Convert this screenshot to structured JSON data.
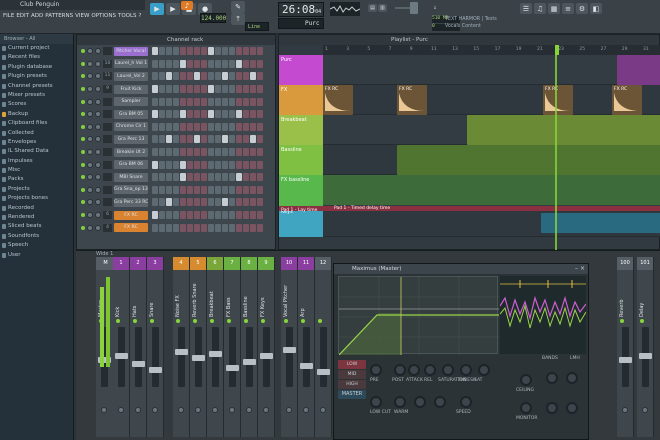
{
  "window": {
    "title": "Club Penguin"
  },
  "menu": [
    "FILE",
    "EDIT",
    "ADD",
    "PATTERNS",
    "VIEW",
    "OPTIONS",
    "TOOLS",
    "?"
  ],
  "transport": {
    "tempo": "124.000",
    "time": "26:08",
    "time_small": "04",
    "pattern": "Purc",
    "line_mode": "Line",
    "cpu": "510 MB",
    "cpu2": "0"
  },
  "hint": {
    "line1": "TEXT HARMOR | Tests",
    "line2": "Vocals Content"
  },
  "browser": {
    "header": "Browser - All",
    "items": [
      "Current project",
      "Recent files",
      "Plugin database",
      "Plugin presets",
      "Channel presets",
      "Mixer presets",
      "Scores",
      "Backup",
      "Clipboard files",
      "Collected",
      "Envelopes",
      "IL Shared Data",
      "Impulses",
      "Misc",
      "Packs",
      "Projects",
      "Projects bones",
      "Recorded",
      "Rendered",
      "Sliced beats",
      "Soundfonts",
      "Speech",
      "User"
    ]
  },
  "channel_rack": {
    "title": "Channel rack",
    "channels": [
      {
        "num": "",
        "name": "Pitcher Vocal"
      },
      {
        "num": "10",
        "name": "Laurel_h Vol 1"
      },
      {
        "num": "11",
        "name": "Laurel_Vol 2"
      },
      {
        "num": "9",
        "name": "Fruit Kick"
      },
      {
        "num": "",
        "name": "Sampler"
      },
      {
        "num": "",
        "name": "Gra BM 05"
      },
      {
        "num": "",
        "name": "Chrome Clr 1"
      },
      {
        "num": "",
        "name": "Gra Perc 13"
      },
      {
        "num": "",
        "name": "Breakie Ut 2"
      },
      {
        "num": "",
        "name": "Gra BM 06"
      },
      {
        "num": "",
        "name": "MBI Snare"
      },
      {
        "num": "",
        "name": "Gra Sna_op 13"
      },
      {
        "num": "",
        "name": "Gra Perc 33 RC"
      },
      {
        "num": "6",
        "name": "FX RC"
      },
      {
        "num": "4",
        "name": "FX RC"
      }
    ]
  },
  "playlist": {
    "title": "Playlist - Purc",
    "ruler": [
      "1",
      "3",
      "5",
      "7",
      "9",
      "11",
      "13",
      "15",
      "17",
      "19",
      "21",
      "23",
      "25",
      "27",
      "29",
      "31"
    ],
    "tracks": [
      {
        "name": "Purc",
        "color": "#c44bd0"
      },
      {
        "name": "FX",
        "color": "#d89a3c"
      },
      {
        "name": "Breakbeat",
        "color": "#9ac04a"
      },
      {
        "name": "Bassline",
        "color": "#7fc043"
      },
      {
        "name": "FX bassline",
        "color": "#58b84b"
      },
      {
        "name": "Keys",
        "color": "#3fa5c0"
      }
    ],
    "clip_labels": {
      "fx": "FX RC",
      "auto": "Pad 1 - Lay time",
      "auto2": "Pad 1 - Timed delay time"
    }
  },
  "mixer": {
    "title": "Wide 1",
    "strips": [
      {
        "label": "M",
        "name": "Master",
        "color": "#565f65"
      },
      {
        "label": "1",
        "name": "Kick",
        "color": "#8a3ea0"
      },
      {
        "label": "2",
        "name": "Hats",
        "color": "#8a3ea0"
      },
      {
        "label": "3",
        "name": "Snare",
        "color": "#8a3ea0"
      },
      {
        "label": "4",
        "name": "Noise FX",
        "color": "#d68b2e"
      },
      {
        "label": "5",
        "name": "Reverb Snare",
        "color": "#d68b2e"
      },
      {
        "label": "6",
        "name": "Breakbeat",
        "color": "#7aa63a"
      },
      {
        "label": "7",
        "name": "FX Bass",
        "color": "#6bb042"
      },
      {
        "label": "8",
        "name": "Bassline",
        "color": "#6bb042"
      },
      {
        "label": "9",
        "name": "FX Keys",
        "color": "#6bb042"
      },
      {
        "label": "10",
        "name": "Vocal Pitcher",
        "color": "#8a3ea0"
      },
      {
        "label": "11",
        "name": "Arp",
        "color": "#8a3ea0"
      },
      {
        "label": "12",
        "name": "",
        "color": "#565f65"
      },
      {
        "label": "100",
        "name": "Reverb",
        "color": "#565f65"
      },
      {
        "label": "101",
        "name": "Delay",
        "color": "#565f65"
      }
    ]
  },
  "maximus": {
    "title": "Maximus (Master)",
    "bands": [
      "LOW",
      "MID",
      "HIGH"
    ],
    "master": "MASTER",
    "labels": [
      "PRE",
      "POST",
      "ATTACK",
      "REL",
      "SATURATION",
      "THRESH",
      "SAT",
      "CEILING",
      "LOW CUT",
      "WARM",
      "SPEED",
      "MONITOR",
      "BANDS",
      "LMH"
    ]
  }
}
